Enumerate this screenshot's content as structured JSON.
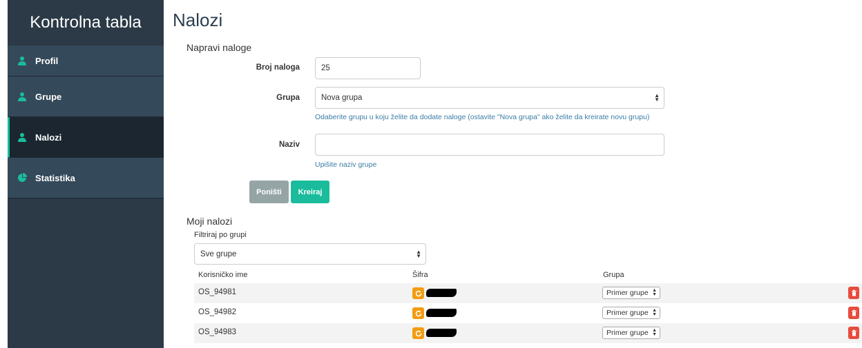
{
  "sidebar": {
    "title": "Kontrolna tabla",
    "items": [
      {
        "label": "Profil",
        "icon": "user-icon"
      },
      {
        "label": "Grupe",
        "icon": "user-icon"
      },
      {
        "label": "Nalozi",
        "icon": "user-icon",
        "active": true
      },
      {
        "label": "Statistika",
        "icon": "pie-chart-icon"
      }
    ]
  },
  "page": {
    "title": "Nalozi"
  },
  "create": {
    "section_title": "Napravi naloge",
    "count_label": "Broj naloga",
    "count_value": "25",
    "group_label": "Grupa",
    "group_value": "Nova grupa",
    "group_help": "Odaberite grupu u koju želite da dodate naloge (ostavite \"Nova grupa\" ako želite da kreirate novu grupu)",
    "name_label": "Naziv",
    "name_value": "",
    "name_help": "Upišite naziv grupe",
    "cancel_label": "Poništi",
    "create_label": "Kreiraj"
  },
  "accounts": {
    "section_title": "Moji nalozi",
    "filter_label": "Filtriraj po grupi",
    "filter_value": "Sve grupe",
    "columns": [
      "Korisničko ime",
      "Šifra",
      "Grupa"
    ],
    "rows": [
      {
        "username": "OS_94981",
        "group": "Primer grupe"
      },
      {
        "username": "OS_94982",
        "group": "Primer grupe"
      },
      {
        "username": "OS_94983",
        "group": "Primer grupe"
      }
    ]
  },
  "colors": {
    "sidebar_bg": "#34495a",
    "accent": "#1abc9c",
    "refresh": "#f39c12",
    "delete": "#e74c3c"
  }
}
